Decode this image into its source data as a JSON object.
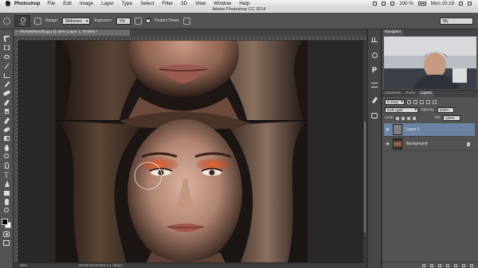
{
  "menubar": {
    "app_name": "Photoshop",
    "items": [
      "File",
      "Edit",
      "Image",
      "Layer",
      "Type",
      "Select",
      "Filter",
      "3D",
      "View",
      "Window",
      "Help"
    ],
    "battery": "100 %",
    "clock": "Mon 20:19"
  },
  "window": {
    "title": "Adobe Photoshop CC 2014"
  },
  "options": {
    "brush_size": "700",
    "range_label": "Range:",
    "range_value": "Midtones",
    "exposure_label": "Exposure:",
    "exposure_value": "5%",
    "protect_tones_label": "Protect Tones",
    "protect_tones_checked": true,
    "workspace": "My"
  },
  "document": {
    "tab_title": "59eb5606a0db.jpg @ 25% (Layer 1, RGB/8) *",
    "zoom": "25%",
    "color_profile": "sRGB IEC61966-2.1 (8bpc)"
  },
  "tools": [
    "move",
    "marquee",
    "lasso",
    "quick-selection",
    "crop",
    "eyedropper",
    "healing-brush",
    "brush",
    "clone-stamp",
    "history-brush",
    "eraser",
    "gradient",
    "blur",
    "dodge",
    "pen",
    "type",
    "path-selection",
    "rectangle",
    "hand",
    "zoom"
  ],
  "colors": {
    "foreground": "#000000",
    "background": "#ffffff",
    "selection": "#6d83a3",
    "makeup": "#e0562a"
  },
  "right_strip": {
    "p_label": "P"
  },
  "navigator": {
    "tab": "Navigator"
  },
  "layers_panel": {
    "tabs": [
      "Channels",
      "Paths",
      "Layers"
    ],
    "active_tab": "Layers",
    "filter_kind": "Kind",
    "blend_mode": "Soft Light",
    "opacity_label": "Opacity:",
    "opacity_value": "100%",
    "lock_label": "Lock:",
    "fill_label": "Fill:",
    "fill_value": "100%",
    "layers": [
      {
        "name": "Layer 1",
        "selected": true,
        "locked": false
      },
      {
        "name": "Background",
        "selected": false,
        "locked": true
      }
    ]
  }
}
